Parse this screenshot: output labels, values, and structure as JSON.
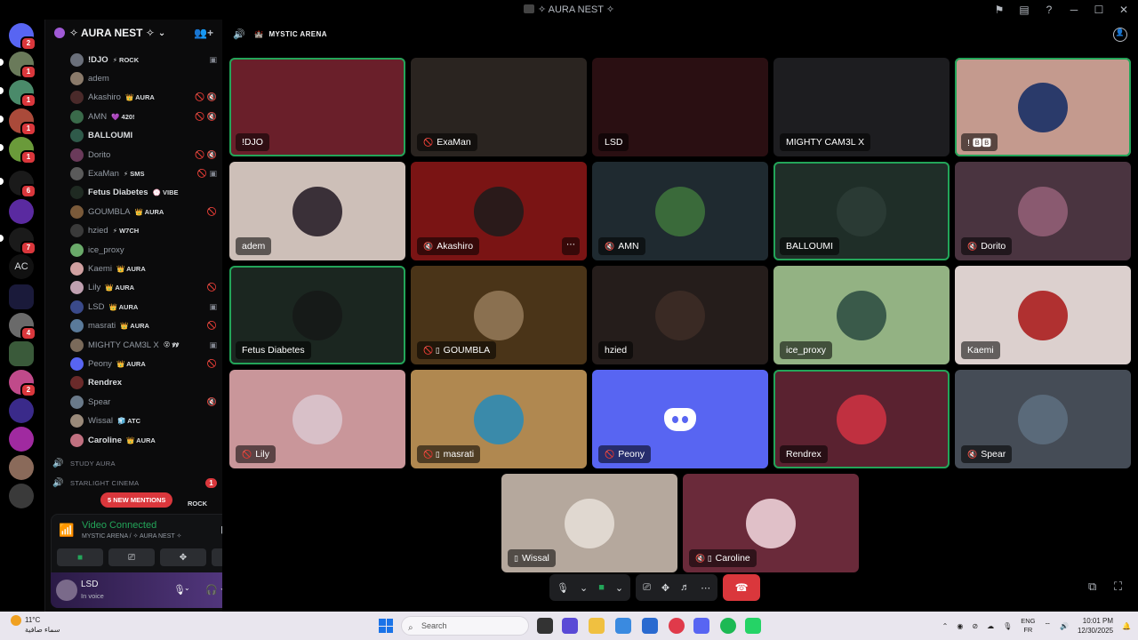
{
  "window": {
    "title": "✧ AURA NEST ✧"
  },
  "server_rail": {
    "text_server": "AC",
    "badges": [
      "2",
      "1",
      "1",
      "1",
      "1",
      "6",
      "7",
      "4",
      "2"
    ]
  },
  "guild": {
    "name": "✧ AURA NEST ✧"
  },
  "members": [
    {
      "name": "!DJO",
      "tag": "⚡ ROCK",
      "bright": true,
      "color": "#6a6f7a",
      "icons": "▣"
    },
    {
      "name": "adem",
      "tag": "",
      "bright": false,
      "color": "#8a7a6a",
      "icons": ""
    },
    {
      "name": "Akashiro",
      "tag": "👑 AURA",
      "bright": false,
      "color": "#4a2a2a",
      "icons": "🚫 🔇"
    },
    {
      "name": "AMN",
      "tag": "💜 420!",
      "bright": false,
      "color": "#3a6a4a",
      "icons": "🚫 🔇"
    },
    {
      "name": "BALLOUMI",
      "tag": "",
      "bright": true,
      "color": "#2f5a4a",
      "icons": ""
    },
    {
      "name": "Dorito",
      "tag": "",
      "bright": false,
      "color": "#6a3a5a",
      "icons": "🚫 🔇"
    },
    {
      "name": "ExaMan",
      "tag": "⚡ SMS",
      "bright": false,
      "color": "#5a5a5a",
      "icons": "🚫 ▣"
    },
    {
      "name": "Fetus Diabetes",
      "tag": "💮 VIBE",
      "bright": true,
      "color": "#1f2a22",
      "icons": ""
    },
    {
      "name": "GOUMBLA",
      "tag": "👑 AURA",
      "bright": false,
      "color": "#7a5a3a",
      "icons": "🚫"
    },
    {
      "name": "hzied",
      "tag": "⚡ W7CH",
      "bright": false,
      "color": "#3a3a3a",
      "icons": ""
    },
    {
      "name": "ice_proxy",
      "tag": "",
      "bright": false,
      "color": "#6aaa6a",
      "icons": ""
    },
    {
      "name": "Kaemi",
      "tag": "👑 AURA",
      "bright": false,
      "color": "#d0a0a0",
      "icons": ""
    },
    {
      "name": "Lily",
      "tag": "👑 AURA",
      "bright": false,
      "color": "#c0a0b0",
      "icons": "🚫"
    },
    {
      "name": "LSD",
      "tag": "👑 AURA",
      "bright": false,
      "color": "#3a4a8a",
      "icons": "▣"
    },
    {
      "name": "masrati",
      "tag": "👑 AURA",
      "bright": false,
      "color": "#5a7a9a",
      "icons": "🚫"
    },
    {
      "name": "MIGHTY CAM3L X",
      "tag": "😵 ꝟꝟ",
      "bright": false,
      "color": "#7a6a5a",
      "icons": "▣"
    },
    {
      "name": "Peony",
      "tag": "👑 AURA",
      "bright": false,
      "color": "#5865f2",
      "icons": "🚫"
    },
    {
      "name": "Rendrex",
      "tag": "",
      "bright": true,
      "color": "#6a2a2a",
      "icons": ""
    },
    {
      "name": "Spear",
      "tag": "",
      "bright": false,
      "color": "#6a7a8a",
      "icons": "🔇"
    },
    {
      "name": "Wissal",
      "tag": "🧊 ATC",
      "bright": false,
      "color": "#9a8a7a",
      "icons": ""
    },
    {
      "name": "Caroline",
      "tag": "👑 AURA",
      "bright": true,
      "color": "#c07080",
      "icons": ""
    }
  ],
  "voice_channels": [
    {
      "name": "STUDY AURA",
      "count": ""
    },
    {
      "name": "STARLIGHT CINEMA",
      "count": "1"
    }
  ],
  "partial_member": {
    "tag": "ROCK"
  },
  "new_mentions": "5 NEW MENTIONS",
  "voice_panel": {
    "status": "Video Connected",
    "location": "MYSTIC ARENA / ✧ AURA NEST ✧"
  },
  "user_panel": {
    "name": "LSD",
    "status": "In voice"
  },
  "channel": {
    "name": "MYSTIC ARENA"
  },
  "tiles": [
    {
      "name": "!DJO",
      "bg": "#6a1f2a",
      "muted": "",
      "speaking": true,
      "avatar": ""
    },
    {
      "name": "ExaMan",
      "bg": "#2a2420",
      "muted": "🚫",
      "speaking": false,
      "avatar": ""
    },
    {
      "name": "LSD",
      "bg": "#2a0f12",
      "muted": "",
      "speaking": false,
      "avatar": ""
    },
    {
      "name": "MIGHTY CAM3L X",
      "bg": "#1d1d20",
      "muted": "",
      "speaking": false,
      "avatar": ""
    },
    {
      "name": "! 🅱🅱",
      "bg": "#c49a8e",
      "muted": "",
      "speaking": true,
      "avatar": "#2a3a6a"
    },
    {
      "name": "adem",
      "bg": "#cdbfb8",
      "muted": "",
      "speaking": false,
      "avatar": "#3a3038"
    },
    {
      "name": "Akashiro",
      "bg": "#7a1414",
      "muted": "🔇",
      "speaking": false,
      "avatar": "#2a1a1a",
      "more": true
    },
    {
      "name": "AMN",
      "bg": "#1f2a30",
      "muted": "🔇",
      "speaking": false,
      "avatar": "#3a6a3a"
    },
    {
      "name": "BALLOUMI",
      "bg": "#1f2e28",
      "muted": "",
      "speaking": true,
      "avatar": "#2a3a34"
    },
    {
      "name": "Dorito",
      "bg": "#4a3440",
      "muted": "🔇",
      "speaking": false,
      "avatar": "#8a5a70"
    },
    {
      "name": "Fetus Diabetes",
      "bg": "#1b2620",
      "muted": "",
      "speaking": true,
      "avatar": "#161a18"
    },
    {
      "name": "GOUMBLA",
      "bg": "#4a3418",
      "muted": "🚫 ▯",
      "speaking": false,
      "avatar": "#8a7050"
    },
    {
      "name": "hzied",
      "bg": "#251d1b",
      "muted": "",
      "speaking": false,
      "avatar": "#3a2a24"
    },
    {
      "name": "ice_proxy",
      "bg": "#93b283",
      "muted": "",
      "speaking": false,
      "avatar": "#3a5a4a"
    },
    {
      "name": "Kaemi",
      "bg": "#dcd0ce",
      "muted": "",
      "speaking": false,
      "avatar": "#b03030"
    },
    {
      "name": "Lily",
      "bg": "#c9969a",
      "muted": "🚫",
      "speaking": false,
      "avatar": "#d8c0c8"
    },
    {
      "name": "masrati",
      "bg": "#b08850",
      "muted": "🚫 ▯",
      "speaking": false,
      "avatar": "#3a8aaa"
    },
    {
      "name": "Peony",
      "bg": "#5865f2",
      "muted": "🚫",
      "speaking": false,
      "avatar": "",
      "discord": true
    },
    {
      "name": "Rendrex",
      "bg": "#5a2230",
      "muted": "",
      "speaking": true,
      "avatar": "#c03040"
    },
    {
      "name": "Spear",
      "bg": "#454c56",
      "muted": "🔇",
      "speaking": false,
      "avatar": "#5a6a7a"
    },
    {
      "name": "Wissal",
      "bg": "#b5a89d",
      "muted": "▯",
      "speaking": false,
      "avatar": "#e0d8d0"
    },
    {
      "name": "Caroline",
      "bg": "#6a2a3a",
      "muted": "🔇 ▯",
      "speaking": false,
      "avatar": "#e0c0c8"
    }
  ],
  "taskbar": {
    "temp": "11°C",
    "weather_desc": "سماء صافية",
    "search_placeholder": "Search",
    "lang_top": "ENG",
    "lang_bottom": "FR",
    "time": "10:01 PM",
    "date": "12/30/2025"
  }
}
